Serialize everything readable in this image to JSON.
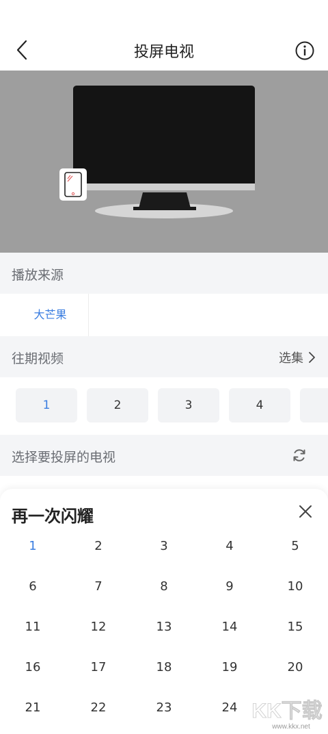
{
  "header": {
    "title": "投屏电视"
  },
  "colors": {
    "accent": "#3a7de0",
    "stage_bg": "#9e9e9e",
    "section_bg": "#f4f5f7"
  },
  "icons": [
    "chevron-left-icon",
    "info-icon",
    "chevron-right-icon",
    "refresh-icon",
    "close-icon",
    "tv-icon",
    "phone-icon"
  ],
  "source": {
    "label": "播放来源",
    "items": [
      "大芒果"
    ]
  },
  "episodes": {
    "label": "往期视频",
    "select_label": "选集",
    "chips": [
      "1",
      "2",
      "3",
      "4"
    ]
  },
  "device": {
    "label": "选择要投屏的电视"
  },
  "sheet": {
    "title": "再一次闪耀",
    "episodes": [
      "1",
      "2",
      "3",
      "4",
      "5",
      "6",
      "7",
      "8",
      "9",
      "10",
      "11",
      "12",
      "13",
      "14",
      "15",
      "16",
      "17",
      "18",
      "19",
      "20",
      "21",
      "22",
      "23",
      "24"
    ]
  },
  "watermark": {
    "text": "KK下载",
    "url": "www.kkx.net"
  }
}
